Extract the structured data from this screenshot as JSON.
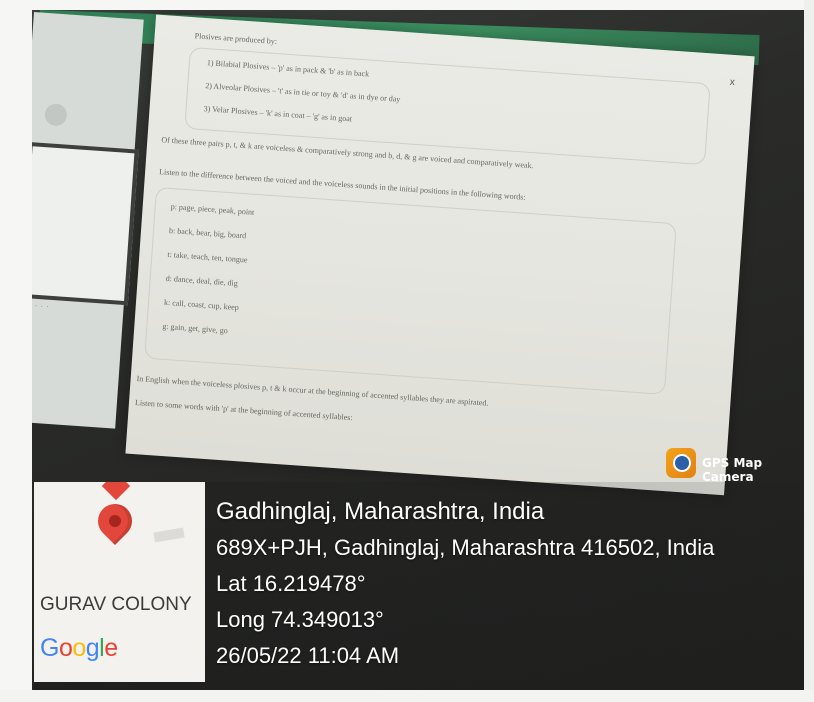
{
  "gps_badge": {
    "label": "GPS Map Camera",
    "icon": "gps-map-camera-icon"
  },
  "map": {
    "place_label": "GURAV COLONY",
    "brand": [
      "G",
      "o",
      "o",
      "g",
      "l",
      "e"
    ],
    "pin_icon": "map-pin-icon"
  },
  "location": {
    "city": "Gadhinglaj, Maharashtra, India",
    "address": "689X+PJH, Gadhinglaj, Maharashtra 416502, India",
    "lat": "Lat 16.219478°",
    "long": "Long 74.349013°",
    "datetime": "26/05/22 11:04 AM"
  },
  "screen_document": {
    "heading": "Plosives are produced by:",
    "list1": [
      "1) Bilabial Plosives – 'p' as in pack & 'b' as in back",
      "2) Alveolar Plosives – 't' as in tie or toy & 'd' as in dye or day",
      "3) Velar Plosives – 'k' as in coat – 'g' as in goat"
    ],
    "para1": "Of these three pairs p, t, & k are voiceless & comparatively strong and b, d, & g are voiced and comparatively weak.",
    "para2": "Listen to the difference between the voiced and the voiceless sounds in the initial positions in the following words:",
    "list2": [
      "p: page, piece, peak, point",
      "b: back, bear, big, board",
      "t: take, teach, ten, tongue",
      "d: dance, deal, die, dig",
      "k: call, coast, cup, keep",
      "g: gain, get, give, go"
    ],
    "para3": "In English when the voiceless plosives p, t & k occur at the beginning of accented syllables they are aspirated.",
    "para4": "Listen to some words with 'p' at the beginning of accented syllables:",
    "close_symbol": "x"
  }
}
